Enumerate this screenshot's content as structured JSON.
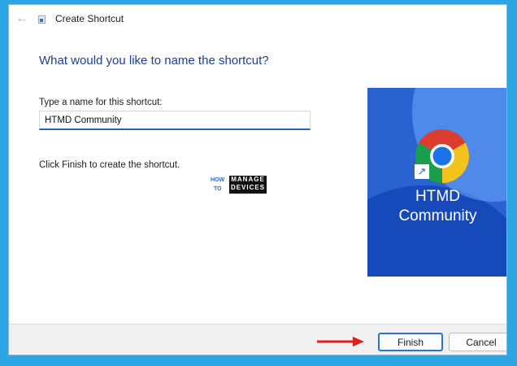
{
  "window": {
    "title": "Create Shortcut"
  },
  "wizard": {
    "heading": "What would you like to name the shortcut?",
    "name_label": "Type a name for this shortcut:",
    "name_value": "HTMD Community",
    "finish_hint": "Click Finish to create the shortcut."
  },
  "logo": {
    "how": "HOW",
    "to": "TO",
    "line1": "MANAGE",
    "line2": "DEVICES"
  },
  "preview": {
    "label_line1": "HTMD",
    "label_line2": "Community",
    "icon": "chrome-icon"
  },
  "buttons": {
    "finish": "Finish",
    "cancel": "Cancel"
  },
  "colors": {
    "accent": "#1f64c1",
    "heading": "#1c3f92",
    "background": "#2aa6e4",
    "annotation_arrow": "#e02020"
  }
}
